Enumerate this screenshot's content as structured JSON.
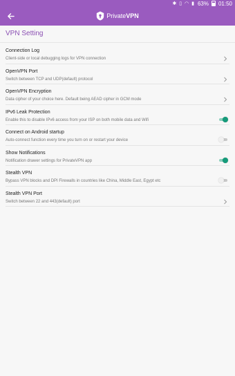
{
  "status_bar": {
    "battery_percent": "63%",
    "time": "01:50",
    "icons": [
      "bluetooth-icon",
      "vibrate-icon",
      "wifi-icon",
      "signal-icon",
      "battery-icon"
    ]
  },
  "app_bar": {
    "back_icon": "arrow-left-icon",
    "brand_regular": "Private",
    "brand_bold": "VPN",
    "logo_icon": "privatevpn-logo-icon",
    "color": "#9a5bbf"
  },
  "page": {
    "section_title": "VPN Setting",
    "accent_color": "#8b4fb3",
    "toggle_on_color": "#159b7a"
  },
  "settings": [
    {
      "title": "Connection Log",
      "desc": "Client-side or local debugging logs for VPN connection",
      "control": "chevron"
    },
    {
      "title": "OpenVPN Port",
      "desc": "Switch between TCP and UDP(default) protocol",
      "control": "chevron"
    },
    {
      "title": "OpenVPN Encryption",
      "desc": "Data cipher of your choice here. Default being AEAD cipher in GCM mode",
      "control": "chevron"
    },
    {
      "title": "IPv6 Leak Protection",
      "desc": "Enable this to disable IPv6 access from your ISP on both mobile data and Wifi",
      "control": "toggle",
      "on": true
    },
    {
      "title": "Connect on Android startup",
      "desc": "Auto-connect function every time you turn on or restart your device",
      "control": "toggle",
      "on": false
    },
    {
      "title": "Show Notifications",
      "desc": "Notification drawer settings for PrivateVPN app",
      "control": "toggle",
      "on": true
    },
    {
      "title": "Stealth VPN",
      "desc": "Bypass VPN blocks and DPI Firewalls in countries like China, Middle East, Egypt etc",
      "control": "toggle",
      "on": false
    },
    {
      "title": "Stealth VPN Port",
      "desc": "Switch between 22 and 443(default) port",
      "control": "chevron"
    }
  ]
}
